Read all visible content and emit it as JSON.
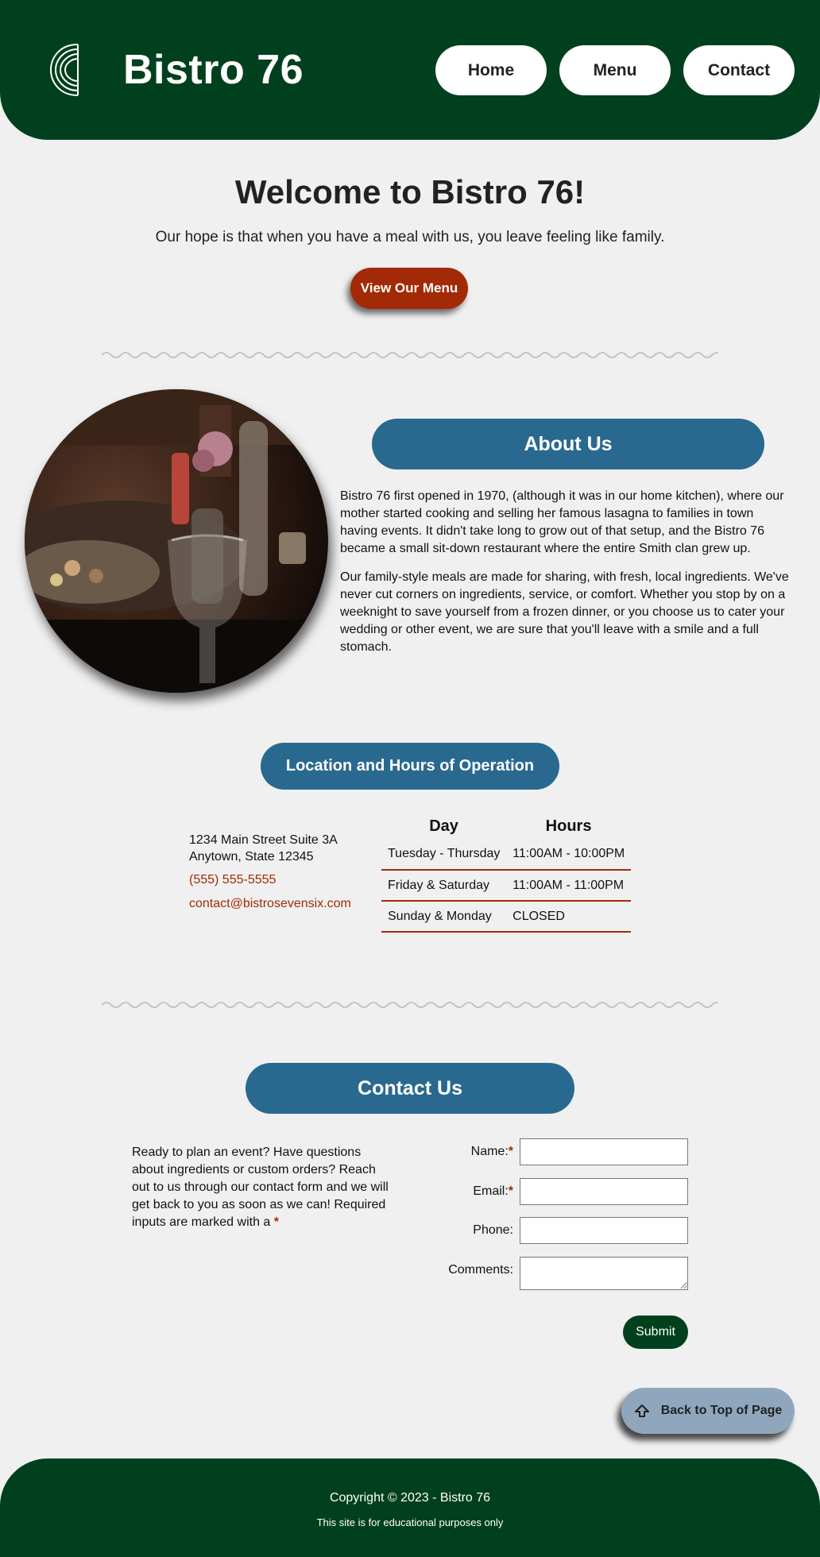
{
  "header": {
    "brand": "Bistro 76",
    "logo_icon": "pasta-swirl-logo",
    "nav": [
      {
        "label": "Home"
      },
      {
        "label": "Menu"
      },
      {
        "label": "Contact"
      }
    ]
  },
  "welcome": {
    "title": "Welcome to Bistro 76!",
    "subtitle": "Our hope is that when you have a meal with us, you leave feeling like family.",
    "cta_label": "View Our Menu"
  },
  "about": {
    "heading": "About Us",
    "paragraphs": [
      "Bistro 76 first opened in 1970, (although it was in our home kitchen), where our mother started cooking and selling her famous lasagna to families in town having events. It didn't take long to grow out of that setup, and the Bistro 76 became a small sit-down restaurant where the entire Smith clan grew up.",
      "Our family-style meals are made for sharing, with fresh, local ingredients. We've never cut corners on ingredients, service, or comfort. Whether you stop by on a weeknight to save yourself from a frozen dinner, or you choose us to cater your wedding or other event, we are sure that you'll leave with a smile and a full stomach."
    ]
  },
  "location": {
    "heading": "Location and Hours of Operation",
    "address_line1": "1234 Main Street Suite 3A",
    "address_line2": "Anytown, State 12345",
    "phone": "(555) 555-5555",
    "email": "contact@bistrosevensix.com",
    "table_headers": [
      "Day",
      "Hours"
    ],
    "rows": [
      {
        "day": "Tuesday - Thursday",
        "hours": "11:00AM - 10:00PM"
      },
      {
        "day": "Friday & Saturday",
        "hours": "11:00AM - 11:00PM"
      },
      {
        "day": "Sunday & Monday",
        "hours": "CLOSED"
      }
    ]
  },
  "contact": {
    "heading": "Contact Us",
    "intro": "Ready to plan an event? Have questions about ingredients or custom orders? Reach out to us through our contact form and we will get back to you as soon as we can! Required inputs are marked with a",
    "required_mark": "*",
    "fields": {
      "name_label": "Name:",
      "email_label": "Email:",
      "phone_label": "Phone:",
      "comments_label": "Comments:",
      "name_value": "",
      "email_value": "",
      "phone_value": ""
    },
    "submit_label": "Submit"
  },
  "back_to_top": {
    "label": "Back to Top of Page",
    "icon": "up-arrow-icon"
  },
  "footer": {
    "copyright": "Copyright © 2023 - Bistro 76",
    "note": "This site is for educational purposes only"
  },
  "colors": {
    "brand_green": "#00401e",
    "accent_red": "#a32a06",
    "pill_blue": "#2a698f",
    "back_top_blue": "#8fa6bd",
    "page_bg": "#f0f0f0"
  }
}
